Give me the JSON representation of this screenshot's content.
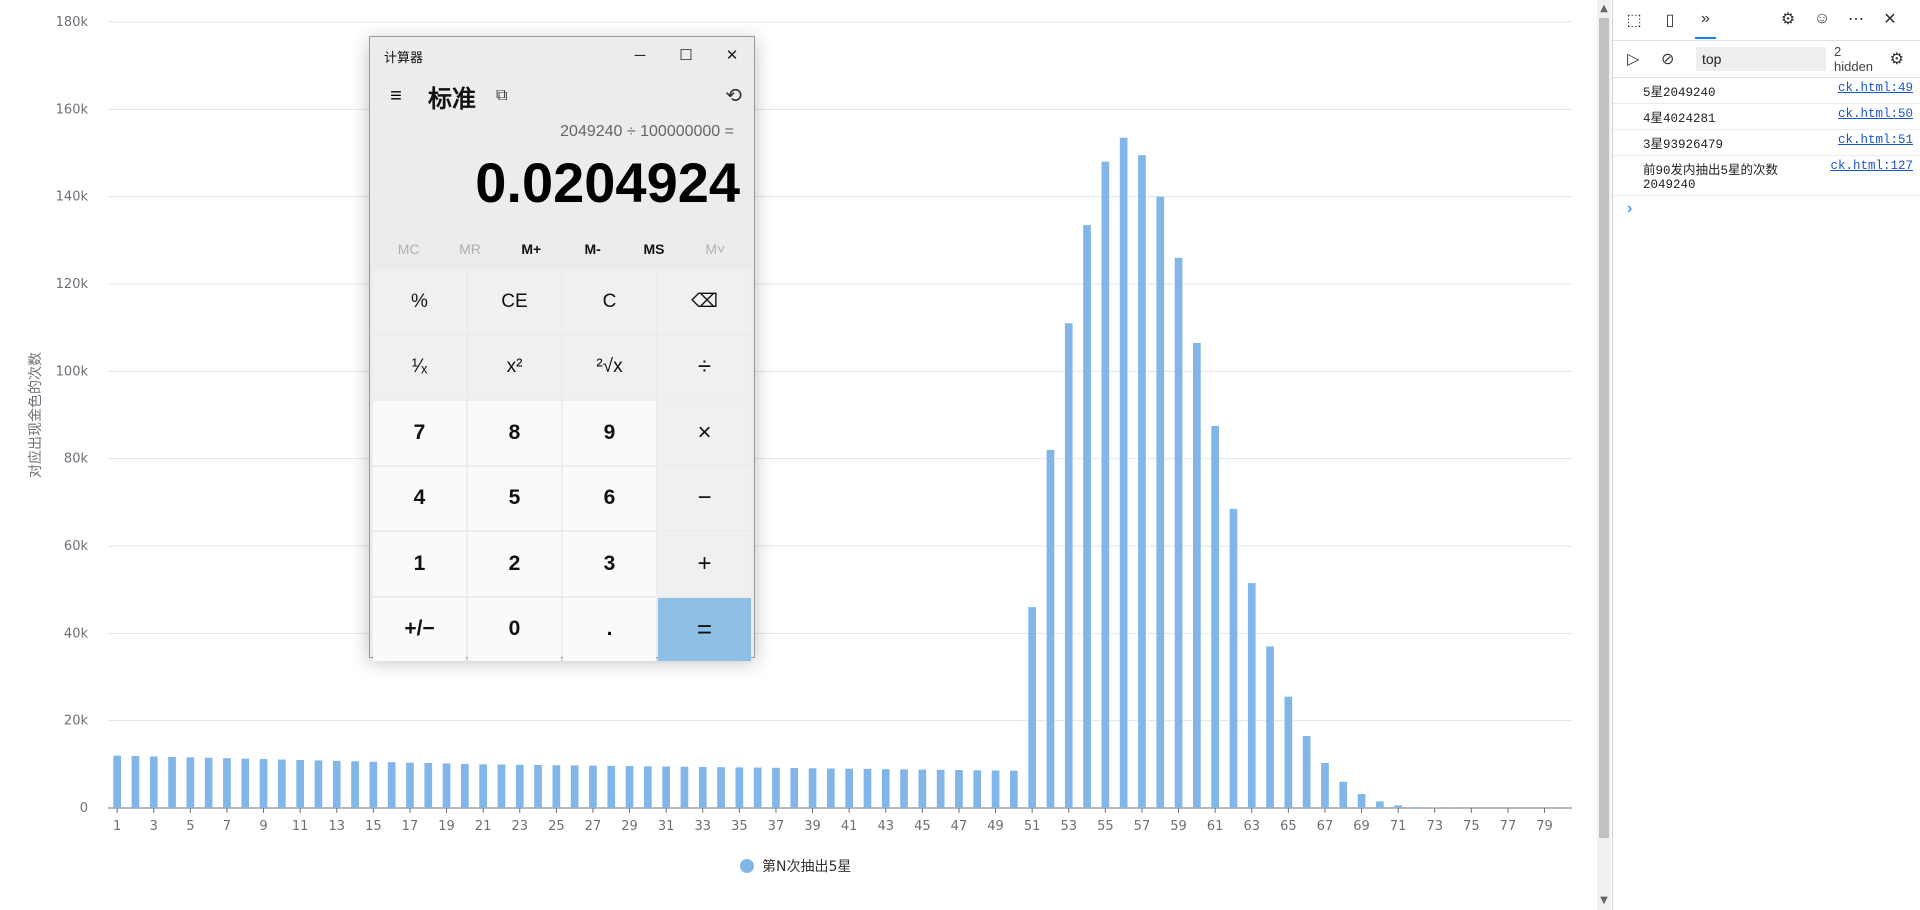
{
  "chart_data": {
    "type": "bar",
    "ylabel": "对应出现金色的次数",
    "ylim": [
      0,
      180000
    ],
    "yticks": [
      "0",
      "20k",
      "40k",
      "60k",
      "80k",
      "100k",
      "120k",
      "140k",
      "160k",
      "180k"
    ],
    "xtick_labels": [
      "1",
      "3",
      "5",
      "7",
      "9",
      "11",
      "13",
      "15",
      "17",
      "19",
      "21",
      "23",
      "25",
      "27",
      "29",
      "31",
      "33",
      "35",
      "37",
      "39",
      "41",
      "43",
      "45",
      "47",
      "49",
      "51",
      "53",
      "55",
      "57",
      "59",
      "61",
      "63",
      "65",
      "67",
      "69",
      "71",
      "73",
      "75",
      "77",
      "79"
    ],
    "categories": [
      1,
      2,
      3,
      4,
      5,
      6,
      7,
      8,
      9,
      10,
      11,
      12,
      13,
      14,
      15,
      16,
      17,
      18,
      19,
      20,
      21,
      22,
      23,
      24,
      25,
      26,
      27,
      28,
      29,
      30,
      31,
      32,
      33,
      34,
      35,
      36,
      37,
      38,
      39,
      40,
      41,
      42,
      43,
      44,
      45,
      46,
      47,
      48,
      49,
      50,
      51,
      52,
      53,
      54,
      55,
      56,
      57,
      58,
      59,
      60,
      61,
      62,
      63,
      64,
      65,
      66,
      67,
      68,
      69,
      70,
      71,
      72,
      73,
      74,
      75,
      76,
      77,
      78,
      79,
      80
    ],
    "series": [
      {
        "name": "第N次抽出5星",
        "color": "#82b6e8",
        "values": [
          12000,
          11900,
          11800,
          11700,
          11600,
          11500,
          11400,
          11300,
          11200,
          11100,
          11000,
          10900,
          10800,
          10700,
          10600,
          10500,
          10400,
          10300,
          10200,
          10100,
          10000,
          9950,
          9900,
          9850,
          9800,
          9750,
          9700,
          9650,
          9600,
          9550,
          9500,
          9450,
          9400,
          9350,
          9300,
          9250,
          9200,
          9150,
          9100,
          9050,
          9000,
          8950,
          8900,
          8850,
          8800,
          8750,
          8700,
          8650,
          8600,
          8550,
          46000,
          82000,
          111000,
          133500,
          148000,
          153500,
          149500,
          140000,
          126000,
          106500,
          87500,
          68500,
          51500,
          37000,
          25500,
          16500,
          10300,
          6000,
          3200,
          1500,
          600,
          200,
          50,
          10,
          0,
          0,
          0,
          0,
          0,
          0
        ]
      }
    ],
    "legend": "bottom-center",
    "grid": true
  },
  "calculator": {
    "title": "计算器",
    "minimize": "─",
    "maximize": "☐",
    "close": "✕",
    "menu_icon": "≡",
    "mode": "标准",
    "keep_on_top_icon": "⧉",
    "history_icon": "⟲",
    "expression": "2049240 ÷ 100000000 =",
    "result": "0.0204924",
    "memory_buttons": [
      {
        "label": "MC",
        "enabled": false
      },
      {
        "label": "MR",
        "enabled": false
      },
      {
        "label": "M+",
        "enabled": true
      },
      {
        "label": "M-",
        "enabled": true
      },
      {
        "label": "MS",
        "enabled": true
      },
      {
        "label": "M˅",
        "enabled": false
      }
    ],
    "keys": [
      {
        "label": "%",
        "kind": "fn",
        "name": "percent-key"
      },
      {
        "label": "CE",
        "kind": "fn",
        "name": "clear-entry-key"
      },
      {
        "label": "C",
        "kind": "fn",
        "name": "clear-key"
      },
      {
        "label": "⌫",
        "kind": "fn",
        "name": "backspace-key"
      },
      {
        "label": "¹⁄ₓ",
        "kind": "fn",
        "name": "reciprocal-key"
      },
      {
        "label": "x²",
        "kind": "fn",
        "name": "square-key"
      },
      {
        "label": "²√x",
        "kind": "fn",
        "name": "sqrt-key"
      },
      {
        "label": "÷",
        "kind": "op",
        "name": "divide-key"
      },
      {
        "label": "7",
        "kind": "num",
        "name": "digit-7-key"
      },
      {
        "label": "8",
        "kind": "num",
        "name": "digit-8-key"
      },
      {
        "label": "9",
        "kind": "num",
        "name": "digit-9-key"
      },
      {
        "label": "×",
        "kind": "op",
        "name": "multiply-key"
      },
      {
        "label": "4",
        "kind": "num",
        "name": "digit-4-key"
      },
      {
        "label": "5",
        "kind": "num",
        "name": "digit-5-key"
      },
      {
        "label": "6",
        "kind": "num",
        "name": "digit-6-key"
      },
      {
        "label": "−",
        "kind": "op",
        "name": "minus-key"
      },
      {
        "label": "1",
        "kind": "num",
        "name": "digit-1-key"
      },
      {
        "label": "2",
        "kind": "num",
        "name": "digit-2-key"
      },
      {
        "label": "3",
        "kind": "num",
        "name": "digit-3-key"
      },
      {
        "label": "+",
        "kind": "op",
        "name": "plus-key"
      },
      {
        "label": "+/−",
        "kind": "num",
        "name": "negate-key"
      },
      {
        "label": "0",
        "kind": "num",
        "name": "digit-0-key"
      },
      {
        "label": ".",
        "kind": "num",
        "name": "decimal-key"
      },
      {
        "label": "=",
        "kind": "eq",
        "name": "equals-key"
      }
    ]
  },
  "devtools": {
    "toolbar_icons": [
      "inspect-icon",
      "device-toggle-icon",
      "more-tabs-icon"
    ],
    "right_icons": [
      "settings-icon",
      "feedback-icon",
      "more-options-icon",
      "close-icon"
    ],
    "filter": {
      "context": "top",
      "hidden": "2 hidden"
    },
    "console": [
      {
        "msg": "5星2049240",
        "src": "ck.html:49"
      },
      {
        "msg": "4星4024281",
        "src": "ck.html:50"
      },
      {
        "msg": "3星93926479",
        "src": "ck.html:51"
      },
      {
        "msg": "前90发内抽出5星的次数\n2049240",
        "src": "ck.html:127"
      }
    ],
    "prompt": "›"
  }
}
